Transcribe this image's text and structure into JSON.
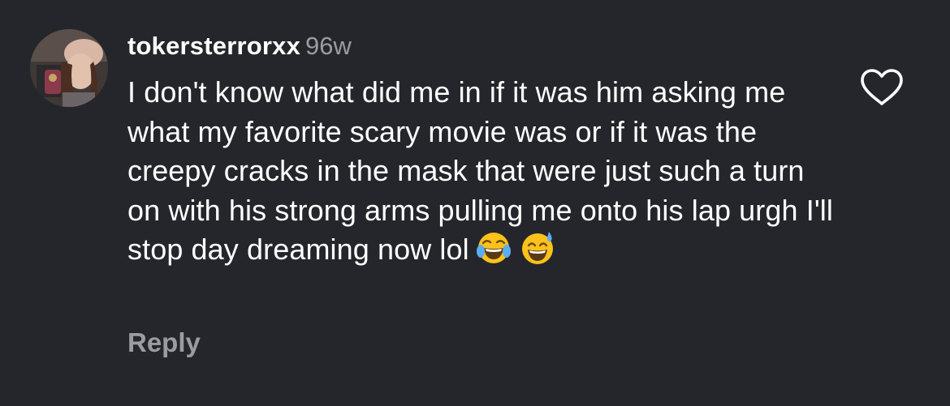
{
  "comment": {
    "username": "tokersterrorxx",
    "age": "96w",
    "text": "I don't know what did me in if it was him asking me what my favorite scary movie was or if it was the creepy cracks in the mask that were just such a turn on with his strong arms pulling me onto his lap urgh I'll stop day dreaming now lol",
    "emojis": [
      "face-with-tears-of-joy",
      "grinning-face-with-sweat"
    ],
    "reply_label": "Reply"
  },
  "icons": {
    "like": "heart-outline-icon"
  },
  "colors": {
    "background": "#24262b",
    "primary_text": "#ffffff",
    "secondary_text": "#9a9ca1",
    "emoji_yellow": "#fcc21b"
  }
}
